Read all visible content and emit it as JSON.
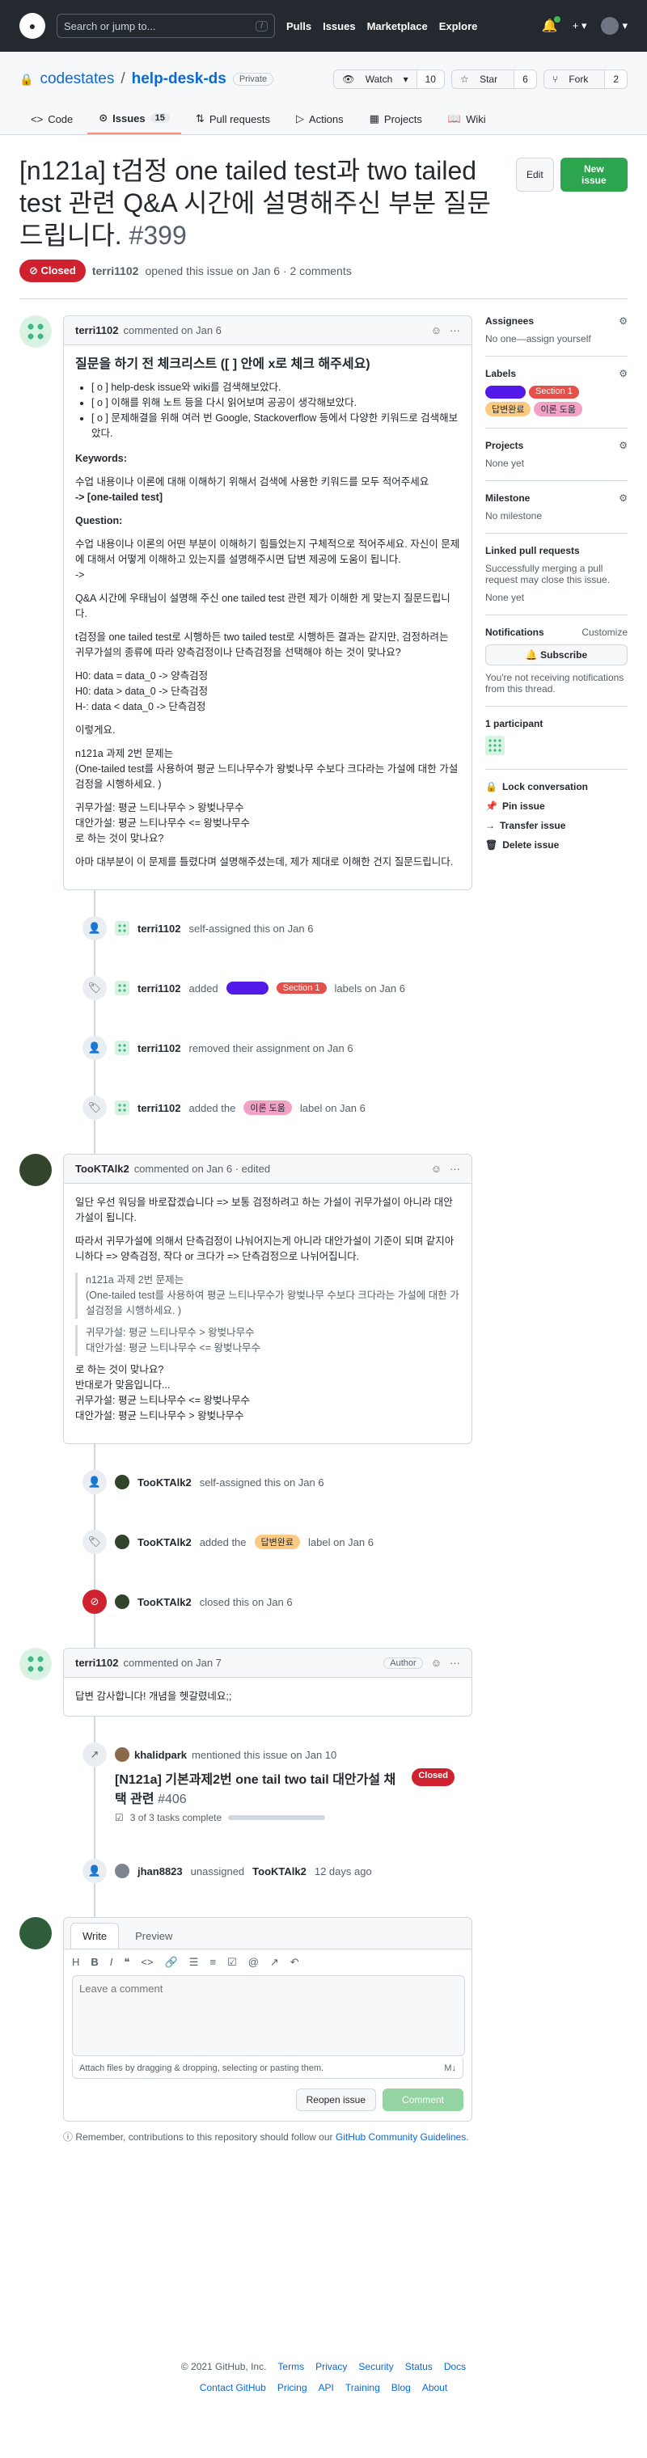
{
  "topbar": {
    "search_placeholder": "Search or jump to...",
    "search_key": "/",
    "nav": [
      "Pulls",
      "Issues",
      "Marketplace",
      "Explore"
    ]
  },
  "repo": {
    "owner": "codestates",
    "name": "help-desk-ds",
    "visibility": "Private",
    "watch_label": "Watch",
    "watch_count": "10",
    "star_label": "Star",
    "star_count": "6",
    "fork_label": "Fork",
    "fork_count": "2"
  },
  "tabs": [
    {
      "label": "Code"
    },
    {
      "label": "Issues",
      "count": "15"
    },
    {
      "label": "Pull requests"
    },
    {
      "label": "Actions"
    },
    {
      "label": "Projects"
    },
    {
      "label": "Wiki"
    }
  ],
  "issue": {
    "title": "[n121a] t검정 one tailed test과 two tailed test 관련 Q&A 시간에 설명해주신 부분 질문 드립니다.",
    "number": "#399",
    "edit_label": "Edit",
    "new_label": "New issue",
    "state": "Closed",
    "opener": "terri1102",
    "meta_text": "opened this issue on Jan 6 · 2 comments"
  },
  "first_comment": {
    "author": "terri1102",
    "when": "commented on Jan 6",
    "heading": "질문을 하기 전 체크리스트 ([ ] 안에 x로 체크 해주세요)",
    "checklist": [
      "[ o ] help-desk issue와 wiki를 검색해보았다.",
      "[ o ] 이해를 위해 노트 등을 다시 읽어보며 공공이 생각해보았다.",
      "[ o ] 문제해결을 위해 여러 번 Google, Stackoverflow 등에서 다양한 키워드로 검색해보았다."
    ],
    "keywords_title": "Keywords:",
    "keywords_text": "수업 내용이나 이론에 대해 이해하기 위해서 검색에 사용한 키워드를 모두 적어주세요",
    "keywords_value": "-> [one-tailed test]",
    "question_title": "Question:",
    "p1": "수업 내용이나 이론의 어떤 부분이 이해하기 힘들었는지 구체적으로 적어주세요. 자신이 문제에 대해서 어떻게 이해하고 있는지를 설명해주시면 답변 제공에 도움이 됩니다.",
    "p1b": "->",
    "p2": "Q&A 시간에 우태님이 설명해 주신 one tailed test 관련 제가 이해한 게 맞는지 질문드립니다.",
    "p3": "t검정을 one tailed test로 시행하든 two tailed test로 시행하든 결과는 같지만, 검정하려는 귀무가설의 종류에 따라 양측검정이나 단측검정을 선택해야 하는 것이 맞나요?",
    "h0": "H0: data = data_0 -> 양측검정",
    "h1": "H0: data > data_0 -> 단측검정",
    "h2": "H-: data < data_0 -> 단측검정",
    "p4": "이렇게요.",
    "p5": "n121a 과제 2번 문제는",
    "p5b": "(One-tailed test를 사용하여 평균 느티나무수가 왕벚나무 수보다 크다라는 가설에 대한 가설검정을 시행하세요. )",
    "p6a": "귀무가설: 평균 느티나무수 > 왕벚나무수",
    "p6b": "대안가설: 평균 느티나무수 <= 왕벚나무수",
    "p6c": "로 하는 것이 맞나요?",
    "p7": "아마 대부분이 이 문제를 틀렸다며 설명해주셨는데, 제가 제대로 이해한 건지 질문드립니다."
  },
  "events1": [
    {
      "icon": "person",
      "user": "terri1102",
      "text": "self-assigned this on Jan 6"
    },
    {
      "icon": "tag",
      "user": "terri1102",
      "pre": "added",
      "labels": [
        "",
        "Section 1"
      ],
      "post": "labels on Jan 6"
    },
    {
      "icon": "person",
      "user": "terri1102",
      "text": "removed their assignment on Jan 6"
    },
    {
      "icon": "tag",
      "user": "terri1102",
      "pre": "added the",
      "labels": [
        "이론 도움"
      ],
      "post": "label on Jan 6"
    }
  ],
  "second_comment": {
    "author": "TooKTAlk2",
    "when": "commented on Jan 6 · edited",
    "p1": "일단 우선 워딩을 바로잡겠습니다 => 보통 검정하려고 하는 가설이 귀무가설이 아니라 대안가설이 됩니다.",
    "p2": "따라서 귀무가설에 의해서 단측검정이 나눠어지는게 아니라 대안가설이 기준이 되며 같지아니하다 => 양측검정, 작다 or 크다가 => 단측검정으로 나뉘어집니다.",
    "q1a": "n121a 과제 2번 문제는",
    "q1b": "(One-tailed test를 사용하여 평균 느티나무수가 왕벚나무 수보다 크다라는 가설에 대한 가설검정을 시행하세요. )",
    "q2a": "귀무가설: 평균 느티나무수 > 왕벚나무수",
    "q2b": "대안가설: 평균 느티나무수 <= 왕벚나무수",
    "p3a": "로 하는 것이 맞나요?",
    "p3b": "반대로가 맞음입니다...",
    "p3c": "귀무가설: 평균 느티나무수 <= 왕벚나무수",
    "p3d": "대안가설: 평균 느티나무수 > 왕벚나무수"
  },
  "events2": [
    {
      "icon": "person",
      "user": "TooKTAlk2",
      "text": "self-assigned this on Jan 6"
    },
    {
      "icon": "tag",
      "user": "TooKTAlk2",
      "pre": "added the",
      "labels": [
        "답변완료"
      ],
      "post": "label on Jan 6"
    },
    {
      "icon": "closed",
      "user": "TooKTAlk2",
      "text": "closed this on Jan 6"
    }
  ],
  "third_comment": {
    "author": "terri1102",
    "when": "commented on Jan 7",
    "tag": "Author",
    "body": "답변 감사합니다! 개념을 헷갈렸네요;;"
  },
  "mention": {
    "user": "khalidpark",
    "text": "mentioned this issue on Jan 10",
    "title": "[N121a] 기본과제2번 one tail two tail 대안가설 채택 관련",
    "number": "#406",
    "state": "Closed",
    "tasks": "3 of 3 tasks complete"
  },
  "unassign": {
    "user": "jhan8823",
    "text": "unassigned",
    "target": "TooKTAlk2",
    "when": "12 days ago"
  },
  "editor": {
    "tab_write": "Write",
    "tab_preview": "Preview",
    "placeholder": "Leave a comment",
    "attach": "Attach files by dragging & dropping, selecting or pasting them.",
    "reopen": "Reopen issue",
    "comment": "Comment",
    "remember": "Remember, contributions to this repository should follow our",
    "guidelines": "GitHub Community Guidelines."
  },
  "sidebar": {
    "assignees_title": "Assignees",
    "assignees_value": "No one—assign yourself",
    "labels_title": "Labels",
    "labels": [
      "",
      "Section 1",
      "답변완료",
      "이론 도움"
    ],
    "projects_title": "Projects",
    "projects_value": "None yet",
    "milestone_title": "Milestone",
    "milestone_value": "No milestone",
    "linked_title": "Linked pull requests",
    "linked_desc": "Successfully merging a pull request may close this issue.",
    "linked_value": "None yet",
    "notif_title": "Notifications",
    "notif_custom": "Customize",
    "subscribe": "Subscribe",
    "notif_desc": "You're not receiving notifications from this thread.",
    "participants": "1 participant",
    "lock": "Lock conversation",
    "pin": "Pin issue",
    "transfer": "Transfer issue",
    "delete": "Delete issue"
  },
  "footer": {
    "copyright": "© 2021 GitHub, Inc.",
    "row1": [
      "Terms",
      "Privacy",
      "Security",
      "Status",
      "Docs"
    ],
    "row2": [
      "Contact GitHub",
      "Pricing",
      "API",
      "Training",
      "Blog",
      "About"
    ]
  }
}
